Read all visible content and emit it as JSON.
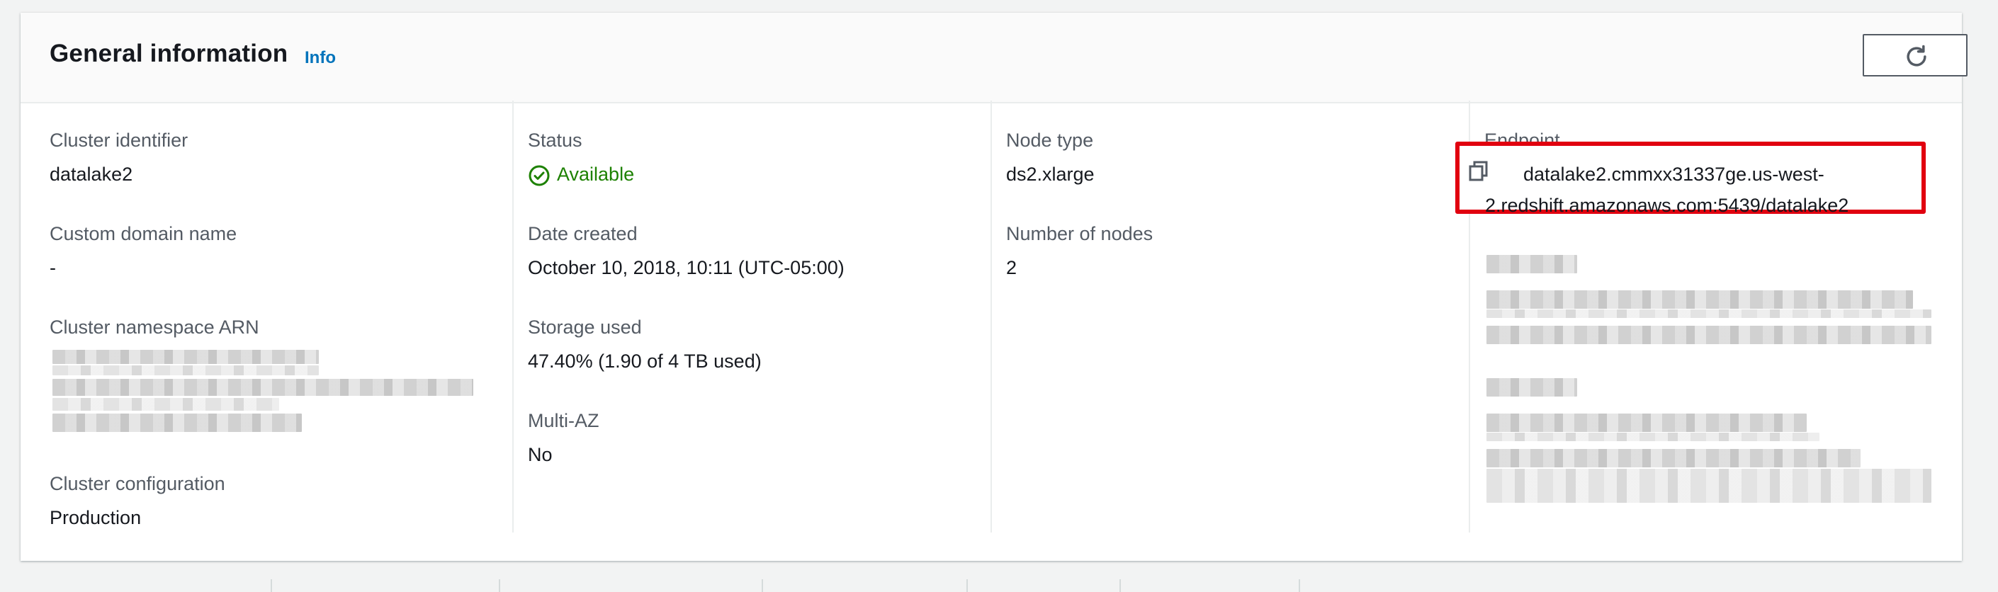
{
  "header": {
    "title": "General information",
    "info_link": "Info",
    "refresh_icon": "refresh-icon"
  },
  "columns": [
    {
      "items": [
        {
          "label": "Cluster identifier",
          "value": "datalake2"
        },
        {
          "label": "Custom domain name",
          "value": "-"
        },
        {
          "label": "Cluster namespace ARN",
          "value": ""
        },
        {
          "label": "Cluster configuration",
          "value": "Production"
        }
      ]
    },
    {
      "items": [
        {
          "label": "Status",
          "value": "Available",
          "icon": "check-circle-icon",
          "color": "#1d8102"
        },
        {
          "label": "Date created",
          "value": "October 10, 2018, 10:11 (UTC-05:00)"
        },
        {
          "label": "Storage used",
          "value": "47.40% (1.90 of 4 TB used)"
        },
        {
          "label": "Multi-AZ",
          "value": "No"
        }
      ]
    },
    {
      "items": [
        {
          "label": "Node type",
          "value": "ds2.xlarge"
        },
        {
          "label": "Number of nodes",
          "value": "2"
        }
      ]
    },
    {
      "items": [
        {
          "label": "Endpoint",
          "value_line1": "datalake2.cmmxx31337ge.us-west-",
          "value_line2": "2.redshift.amazonaws.com:5439/datalake2",
          "icon": "copy-icon",
          "highlight_color": "#e1000f"
        }
      ]
    }
  ],
  "colors": {
    "accent_link": "#0073bb",
    "status_available": "#1d8102",
    "highlight_box": "#e1000f"
  }
}
